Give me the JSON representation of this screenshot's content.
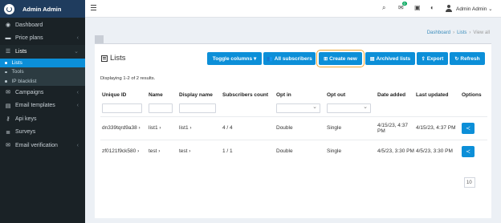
{
  "brand": {
    "name": "Admin Admin"
  },
  "sidebar": {
    "items": [
      {
        "label": "Dashboard",
        "icon": "dashboard-icon",
        "glyph": "◉",
        "chevron": ""
      },
      {
        "label": "Price plans",
        "icon": "price-plans-icon",
        "glyph": "▬",
        "chevron": "‹"
      },
      {
        "label": "Lists",
        "icon": "lists-icon",
        "glyph": "☰",
        "chevron": "⌄"
      }
    ],
    "subitems": [
      {
        "label": "Lists",
        "active": true
      },
      {
        "label": "Tools",
        "active": false
      },
      {
        "label": "IP blacklist",
        "active": false
      }
    ],
    "items_after": [
      {
        "label": "Campaigns",
        "icon": "campaigns-icon",
        "glyph": "✉",
        "chevron": "‹"
      },
      {
        "label": "Email templates",
        "icon": "email-templates-icon",
        "glyph": "▤",
        "chevron": "‹"
      },
      {
        "label": "Api keys",
        "icon": "key-icon",
        "glyph": "⚷",
        "chevron": ""
      },
      {
        "label": "Surveys",
        "icon": "surveys-icon",
        "glyph": "≣",
        "chevron": ""
      },
      {
        "label": "Email verification",
        "icon": "email-verification-icon",
        "glyph": "✉",
        "chevron": "‹"
      }
    ]
  },
  "topbar": {
    "notification_count": "0",
    "user_name": "Admin Admin ⌄"
  },
  "breadcrumb": {
    "items": [
      "Dashboard",
      "Lists",
      "View all"
    ]
  },
  "panel": {
    "title": "Lists",
    "buttons": [
      {
        "label": "Toggle columns ▾",
        "icon": ""
      },
      {
        "label": "All subscribers",
        "icon": "👥"
      },
      {
        "label": "Create new",
        "icon": "⊞"
      },
      {
        "label": "Archived lists",
        "icon": "▤"
      },
      {
        "label": "Export",
        "icon": "⇪"
      },
      {
        "label": "Refresh",
        "icon": "↻"
      }
    ],
    "displaying": "Displaying 1-2 of 2 results."
  },
  "table": {
    "headers": [
      "Unique ID",
      "Name",
      "Display name",
      "Subscribers count",
      "Opt in",
      "Opt out",
      "Date added",
      "Last updated",
      "Options"
    ],
    "rows": [
      {
        "uid": "dn339tqrd9a38 ›",
        "name": "list1 ›",
        "display": "list1 ›",
        "count": "4 / 4",
        "optin": "Double",
        "optout": "Single",
        "added": "4/15/23, 4:37 PM",
        "updated": "4/15/23, 4:37 PM"
      },
      {
        "uid": "zf0121f9ck580 ›",
        "name": "test ›",
        "display": "test ›",
        "count": "1 / 1",
        "optin": "Double",
        "optout": "Single",
        "added": "4/5/23, 3:30 PM",
        "updated": "4/5/23, 3:30 PM"
      }
    ]
  },
  "pager": {
    "value": "10"
  },
  "colors": {
    "accent": "#0c8fd8",
    "sidebar": "#1a2226",
    "highlight": "#f0a530"
  }
}
